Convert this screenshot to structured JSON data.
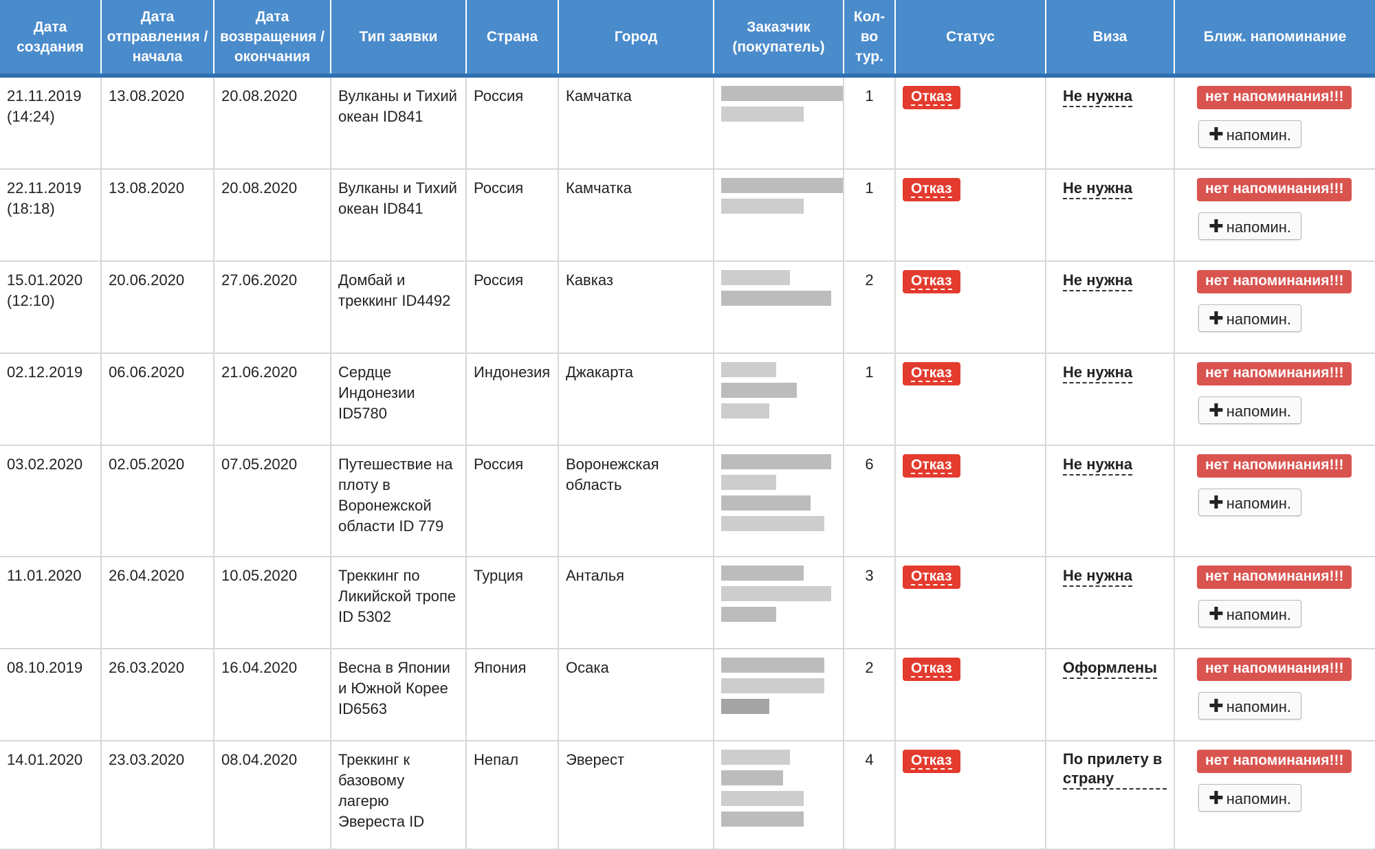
{
  "headers": {
    "created": "Дата создания",
    "depart": "Дата отправления / начала",
    "ret": "Дата возвращения / окончания",
    "type": "Тип заявки",
    "country": "Страна",
    "city": "Город",
    "customer": "Заказчик (покупатель)",
    "qty": "Кол-во тур.",
    "status": "Статус",
    "visa": "Виза",
    "reminder": "Ближ. напоминание"
  },
  "button_label": "напомин.",
  "colors": {
    "header_bg": "#4a8bcb",
    "status_badge": "#e33b2e",
    "reminder_badge": "#d9534f"
  },
  "rows": [
    {
      "created": "21.11.2019",
      "created_time": "(14:24)",
      "depart": "13.08.2020",
      "ret": "20.08.2020",
      "type": "Вулканы и Тихий океан ID841",
      "country": "Россия",
      "city": "Камчатка",
      "qty": "1",
      "status": "Отказ",
      "visa": "Не нужна",
      "reminder": "нет напоминания!!!"
    },
    {
      "created": "22.11.2019",
      "created_time": "(18:18)",
      "depart": "13.08.2020",
      "ret": "20.08.2020",
      "type": "Вулканы и Тихий океан ID841",
      "country": "Россия",
      "city": "Камчатка",
      "qty": "1",
      "status": "Отказ",
      "visa": "Не нужна",
      "reminder": "нет напоминания!!!"
    },
    {
      "created": "15.01.2020",
      "created_time": "(12:10)",
      "depart": "20.06.2020",
      "ret": "27.06.2020",
      "type": "Домбай и треккинг ID4492",
      "country": "Россия",
      "city": "Кавказ",
      "qty": "2",
      "status": "Отказ",
      "visa": "Не нужна",
      "reminder": "нет напоминания!!!"
    },
    {
      "created": "02.12.2019",
      "created_time": "",
      "depart": "06.06.2020",
      "ret": "21.06.2020",
      "type": "Сердце Индонезии ID5780",
      "country": "Индонезия",
      "city": "Джакарта",
      "qty": "1",
      "status": "Отказ",
      "visa": "Не нужна",
      "reminder": "нет напоминания!!!"
    },
    {
      "created": "03.02.2020",
      "created_time": "",
      "depart": "02.05.2020",
      "ret": "07.05.2020",
      "type": "Путешествие на плоту в Воронежской области ID 779",
      "country": "Россия",
      "city": "Воронежская область",
      "qty": "6",
      "status": "Отказ",
      "visa": "Не нужна",
      "reminder": "нет напоминания!!!"
    },
    {
      "created": "11.01.2020",
      "created_time": "",
      "depart": "26.04.2020",
      "ret": "10.05.2020",
      "type": "Треккинг по Ликийской тропе ID 5302",
      "country": "Турция",
      "city": "Анталья",
      "qty": "3",
      "status": "Отказ",
      "visa": "Не нужна",
      "reminder": "нет напоминания!!!"
    },
    {
      "created": "08.10.2019",
      "created_time": "",
      "depart": "26.03.2020",
      "ret": "16.04.2020",
      "type": "Весна в Японии и Южной Корее ID6563",
      "country": "Япония",
      "city": "Осака",
      "qty": "2",
      "status": "Отказ",
      "visa": "Оформлены",
      "reminder": "нет напоминания!!!"
    },
    {
      "created": "14.01.2020",
      "created_time": "",
      "depart": "23.03.2020",
      "ret": "08.04.2020",
      "type": "Треккинг к базовому лагерю Эвереста ID",
      "country": "Непал",
      "city": "Эверест",
      "qty": "4",
      "status": "Отказ",
      "visa": "По прилету в страну",
      "reminder": "нет напоминания!!!"
    }
  ]
}
